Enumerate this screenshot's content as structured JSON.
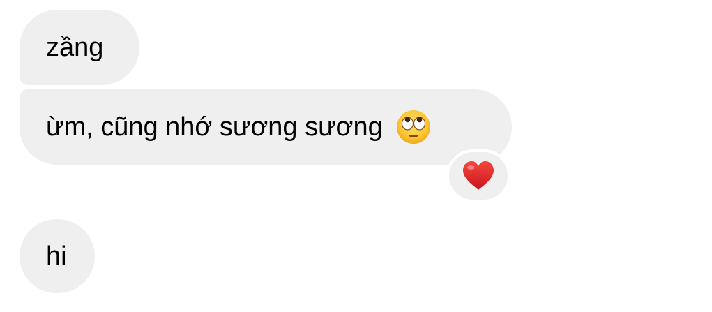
{
  "messages": [
    {
      "text": "zầng",
      "direction": "incoming"
    },
    {
      "text": "ừm, cũng nhớ sương sương",
      "emoji": "face-with-rolling-eyes-icon",
      "direction": "incoming",
      "reaction": "red-heart-icon"
    },
    {
      "text": "hi",
      "direction": "incoming"
    }
  ],
  "colors": {
    "bubble_background": "#efefef",
    "text": "#000000",
    "page_background": "#ffffff",
    "heart": "#e0201e"
  }
}
